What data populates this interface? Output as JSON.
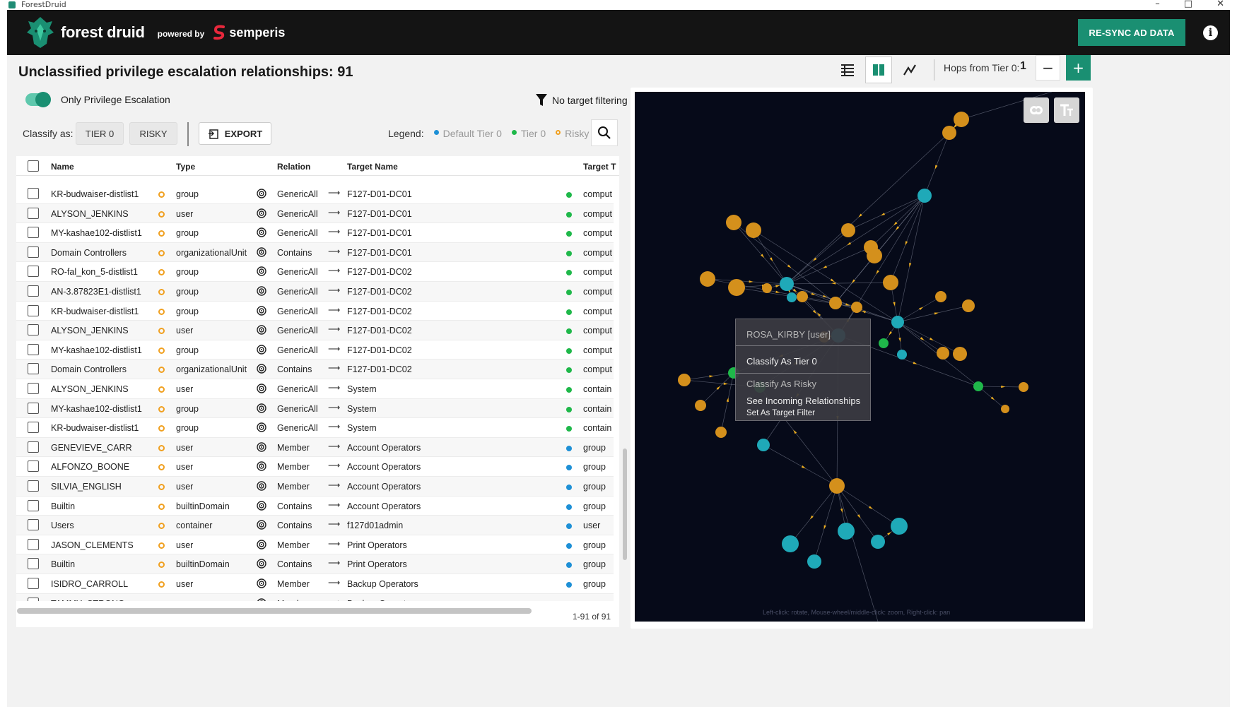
{
  "window": {
    "title": "ForestDruid"
  },
  "header": {
    "brand": "forest druid",
    "powered_by": "powered by",
    "partner": "semperis",
    "resync_label": "RE-SYNC AD DATA",
    "info_glyph": "i"
  },
  "page": {
    "title": "Unclassified privilege escalation relationships: 91"
  },
  "filters": {
    "toggle_label": "Only Privilege Escalation",
    "toggle_on": true,
    "target_filter": "No target filtering"
  },
  "actions": {
    "classify_label": "Classify as:",
    "tier0_label": "TIER 0",
    "risky_label": "RISKY",
    "export_label": "EXPORT"
  },
  "legend": {
    "label": "Legend:",
    "items": [
      {
        "label": "Default Tier 0",
        "color": "#1e90d6"
      },
      {
        "label": "Tier 0",
        "color": "#1fb84a"
      },
      {
        "label": "Risky",
        "color": "#f0a020"
      }
    ]
  },
  "toolbar": {
    "hops_label": "Hops from Tier 0:",
    "hops_value": "1",
    "minus": "−",
    "plus": "+"
  },
  "table": {
    "columns": [
      "Name",
      "Type",
      "Relation",
      "Target Name",
      "Target T"
    ],
    "rows": [
      {
        "name": "KR-budwaiser-distlist1",
        "type": "group",
        "relation": "GenericAll",
        "target": "F127-D01-DC01",
        "target_type": "comput",
        "tier": "tier0"
      },
      {
        "name": "ALYSON_JENKINS",
        "type": "user",
        "relation": "GenericAll",
        "target": "F127-D01-DC01",
        "target_type": "comput",
        "tier": "tier0"
      },
      {
        "name": "MY-kashae102-distlist1",
        "type": "group",
        "relation": "GenericAll",
        "target": "F127-D01-DC01",
        "target_type": "comput",
        "tier": "tier0"
      },
      {
        "name": "Domain Controllers",
        "type": "organizationalUnit",
        "relation": "Contains",
        "target": "F127-D01-DC01",
        "target_type": "comput",
        "tier": "tier0"
      },
      {
        "name": "RO-fal_kon_5-distlist1",
        "type": "group",
        "relation": "GenericAll",
        "target": "F127-D01-DC02",
        "target_type": "comput",
        "tier": "tier0"
      },
      {
        "name": "AN-3.87823E1-distlist1",
        "type": "group",
        "relation": "GenericAll",
        "target": "F127-D01-DC02",
        "target_type": "comput",
        "tier": "tier0"
      },
      {
        "name": "KR-budwaiser-distlist1",
        "type": "group",
        "relation": "GenericAll",
        "target": "F127-D01-DC02",
        "target_type": "comput",
        "tier": "tier0"
      },
      {
        "name": "ALYSON_JENKINS",
        "type": "user",
        "relation": "GenericAll",
        "target": "F127-D01-DC02",
        "target_type": "comput",
        "tier": "tier0"
      },
      {
        "name": "MY-kashae102-distlist1",
        "type": "group",
        "relation": "GenericAll",
        "target": "F127-D01-DC02",
        "target_type": "comput",
        "tier": "tier0"
      },
      {
        "name": "Domain Controllers",
        "type": "organizationalUnit",
        "relation": "Contains",
        "target": "F127-D01-DC02",
        "target_type": "comput",
        "tier": "tier0"
      },
      {
        "name": "ALYSON_JENKINS",
        "type": "user",
        "relation": "GenericAll",
        "target": "System",
        "target_type": "contain",
        "tier": "tier0"
      },
      {
        "name": "MY-kashae102-distlist1",
        "type": "group",
        "relation": "GenericAll",
        "target": "System",
        "target_type": "contain",
        "tier": "tier0"
      },
      {
        "name": "KR-budwaiser-distlist1",
        "type": "group",
        "relation": "GenericAll",
        "target": "System",
        "target_type": "contain",
        "tier": "tier0"
      },
      {
        "name": "GENEVIEVE_CARR",
        "type": "user",
        "relation": "Member",
        "target": "Account Operators",
        "target_type": "group",
        "tier": "default"
      },
      {
        "name": "ALFONZO_BOONE",
        "type": "user",
        "relation": "Member",
        "target": "Account Operators",
        "target_type": "group",
        "tier": "default"
      },
      {
        "name": "SILVIA_ENGLISH",
        "type": "user",
        "relation": "Member",
        "target": "Account Operators",
        "target_type": "group",
        "tier": "default"
      },
      {
        "name": "Builtin",
        "type": "builtinDomain",
        "relation": "Contains",
        "target": "Account Operators",
        "target_type": "group",
        "tier": "default"
      },
      {
        "name": "Users",
        "type": "container",
        "relation": "Contains",
        "target": "f127d01admin",
        "target_type": "user",
        "tier": "default"
      },
      {
        "name": "JASON_CLEMENTS",
        "type": "user",
        "relation": "Member",
        "target": "Print Operators",
        "target_type": "group",
        "tier": "default"
      },
      {
        "name": "Builtin",
        "type": "builtinDomain",
        "relation": "Contains",
        "target": "Print Operators",
        "target_type": "group",
        "tier": "default"
      },
      {
        "name": "ISIDRO_CARROLL",
        "type": "user",
        "relation": "Member",
        "target": "Backup Operators",
        "target_type": "group",
        "tier": "default"
      },
      {
        "name": "TAMMY_STRONG",
        "type": "user",
        "relation": "Member",
        "target": "Backup Operators",
        "target_type": "group",
        "tier": "default"
      }
    ],
    "pagination": "1-91 of 91"
  },
  "graph": {
    "hint": "Left-click: rotate, Mouse-wheel/middle-click: zoom, Right-click: pan",
    "node_colors": {
      "risky": "#d4901c",
      "default_tier0": "#1fa9b8",
      "tier0": "#1fb84a"
    },
    "background": "#060a19",
    "context_menu": {
      "title": "ROSA_KIRBY [user]",
      "items": [
        "Classify As Tier 0",
        "Classify As Risky",
        "See Incoming Relationships",
        "Set As Target Filter"
      ]
    }
  }
}
